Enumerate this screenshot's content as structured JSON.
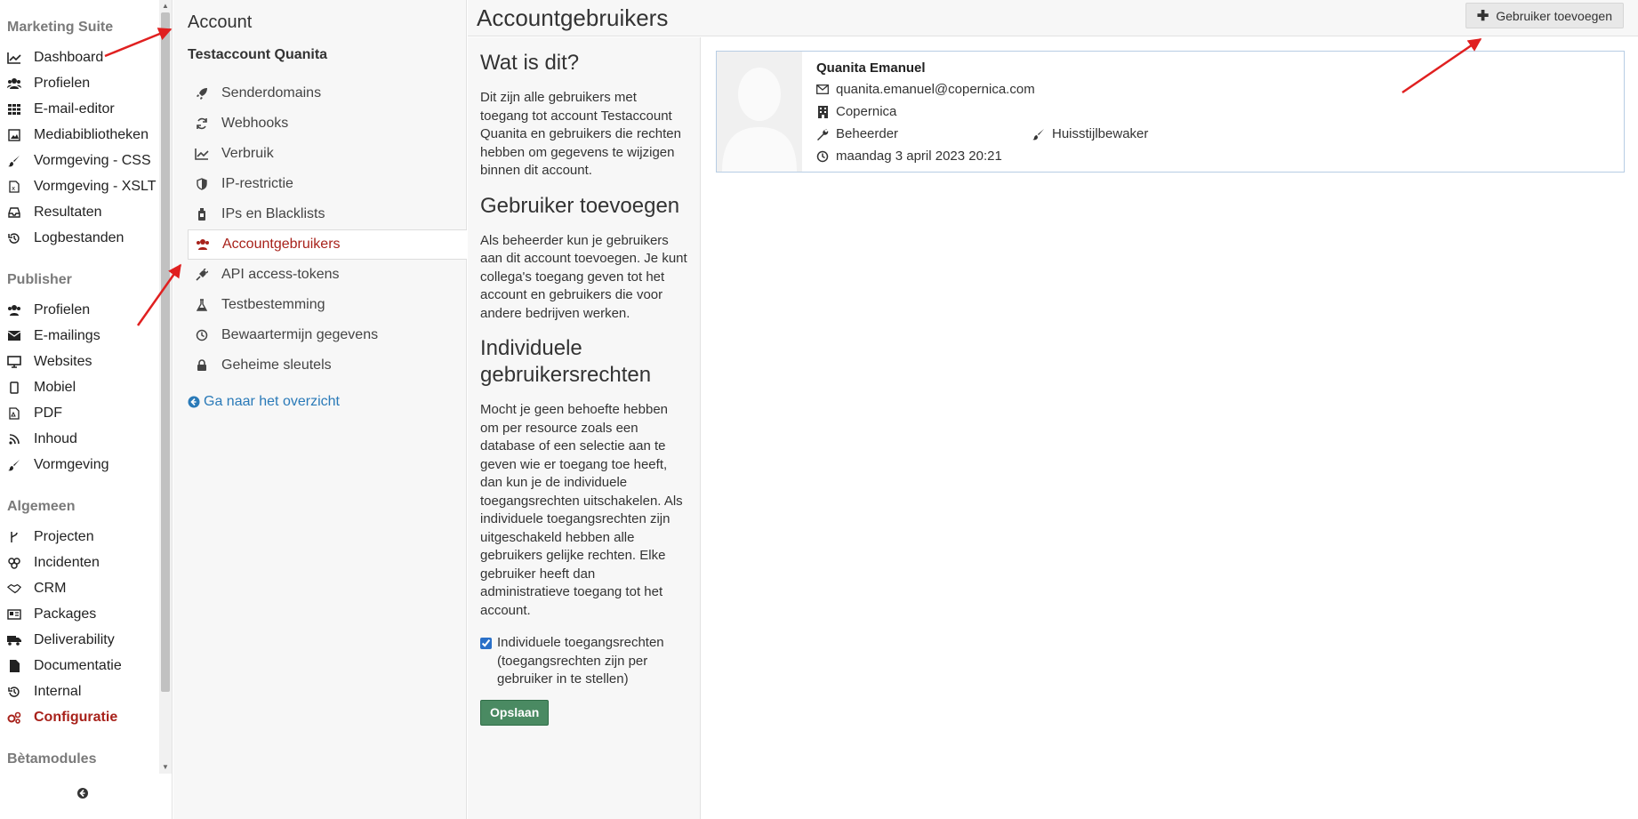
{
  "leftnav": {
    "sections": [
      {
        "title": "Marketing Suite",
        "items": [
          {
            "label": "Dashboard",
            "icon": "line-chart-icon"
          },
          {
            "label": "Profielen",
            "icon": "users-icon"
          },
          {
            "label": "E-mail-editor",
            "icon": "grid-icon"
          },
          {
            "label": "Mediabibliotheken",
            "icon": "image-icon"
          },
          {
            "label": "Vormgeving - CSS",
            "icon": "brush-icon"
          },
          {
            "label": "Vormgeving - XSLT",
            "icon": "file-code-icon"
          },
          {
            "label": "Resultaten",
            "icon": "inbox-icon"
          },
          {
            "label": "Logbestanden",
            "icon": "history-icon"
          }
        ]
      },
      {
        "title": "Publisher",
        "items": [
          {
            "label": "Profielen",
            "icon": "users-icon"
          },
          {
            "label": "E-mailings",
            "icon": "envelope-icon"
          },
          {
            "label": "Websites",
            "icon": "monitor-icon"
          },
          {
            "label": "Mobiel",
            "icon": "mobile-icon"
          },
          {
            "label": "PDF",
            "icon": "pdf-icon"
          },
          {
            "label": "Inhoud",
            "icon": "rss-icon"
          },
          {
            "label": "Vormgeving",
            "icon": "brush-icon"
          }
        ]
      },
      {
        "title": "Algemeen",
        "items": [
          {
            "label": "Projecten",
            "icon": "branch-icon"
          },
          {
            "label": "Incidenten",
            "icon": "bugs-icon"
          },
          {
            "label": "CRM",
            "icon": "handshake-icon"
          },
          {
            "label": "Packages",
            "icon": "id-card-icon"
          },
          {
            "label": "Deliverability",
            "icon": "truck-icon"
          },
          {
            "label": "Documentatie",
            "icon": "document-icon"
          },
          {
            "label": "Internal",
            "icon": "history-icon"
          },
          {
            "label": "Configuratie",
            "icon": "cogs-icon",
            "active": true
          }
        ]
      },
      {
        "title": "Bètamodules",
        "items": []
      }
    ]
  },
  "subnav": {
    "title": "Account",
    "account_name": "Testaccount Quanita",
    "items": [
      {
        "label": "Senderdomains",
        "icon": "rocket-icon"
      },
      {
        "label": "Webhooks",
        "icon": "refresh-icon"
      },
      {
        "label": "Verbruik",
        "icon": "line-chart-icon"
      },
      {
        "label": "IP-restrictie",
        "icon": "shield-icon"
      },
      {
        "label": "IPs en Blacklists",
        "icon": "bottle-icon"
      },
      {
        "label": "Accountgebruikers",
        "icon": "users-icon",
        "active": true
      },
      {
        "label": "API access-tokens",
        "icon": "plug-icon"
      },
      {
        "label": "Testbestemming",
        "icon": "flask-icon"
      },
      {
        "label": "Bewaartermijn gegevens",
        "icon": "clock-icon"
      },
      {
        "label": "Geheime sleutels",
        "icon": "lock-icon"
      }
    ],
    "overview_link": "Ga naar het overzicht"
  },
  "header": {
    "title": "Accountgebruikers",
    "add_button": "Gebruiker toevoegen"
  },
  "info": {
    "heading_1": "Wat is dit?",
    "text_1": "Dit zijn alle gebruikers met toegang tot account Testaccount Quanita en gebruikers die rechten hebben om gegevens te wijzigen binnen dit account.",
    "heading_2": "Gebruiker toevoegen",
    "text_2": "Als beheerder kun je gebruikers aan dit account toevoegen. Je kunt collega's toegang geven tot het account en gebruikers die voor andere bedrijven werken.",
    "heading_3": "Individuele gebruikersrechten",
    "text_3": "Mocht je geen behoefte hebben om per resource zoals een database of een selectie aan te geven wie er toegang toe heeft, dan kun je de individuele toegangsrechten uitschakelen. Als individuele toegangsrechten zijn uitgeschakeld hebben alle gebruikers gelijke rechten. Elke gebruiker heeft dan administratieve toegang tot het account.",
    "checkbox_label": "Individuele toegangsrechten (toegangsrechten zijn per gebruiker in te stellen)",
    "checkbox_checked": true,
    "save_button": "Opslaan"
  },
  "user": {
    "name": "Quanita Emanuel",
    "email": "quanita.emanuel@copernica.com",
    "company": "Copernica",
    "role_1": "Beheerder",
    "role_2": "Huisstijlbewaker",
    "last_login": "maandag 3 april 2023 20:21"
  },
  "colors": {
    "active_red": "#a8221b",
    "link_blue": "#2a7ab8",
    "save_green": "#4a8a62",
    "annotation_red": "#e02020"
  }
}
